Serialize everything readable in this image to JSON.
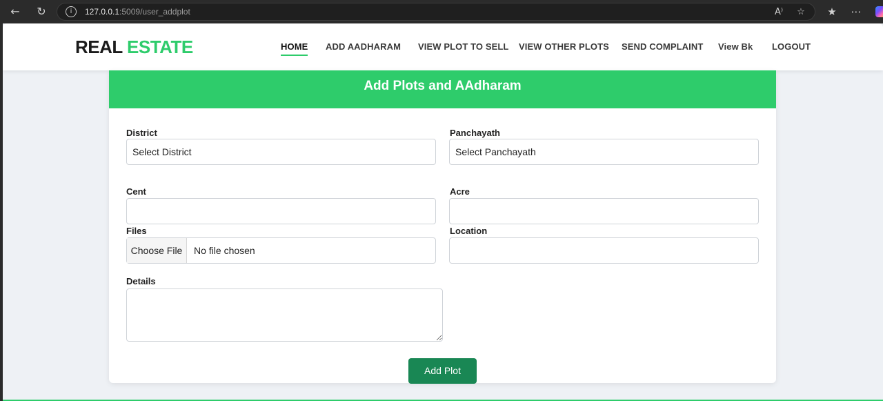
{
  "browser": {
    "url_host": "127.0.0.1",
    "url_rest": ":5009/user_addplot"
  },
  "navbar": {
    "logo_part1": "REAL",
    "logo_part2": "ESTATE",
    "items": [
      {
        "label": "HOME",
        "active": true
      },
      {
        "label": "ADD AADHARAM"
      },
      {
        "label": "VIEW PLOT TO SELL"
      },
      {
        "label": "VIEW OTHER PLOTS"
      },
      {
        "label": "SEND COMPLAINT"
      },
      {
        "label": "View Bk"
      },
      {
        "label": "LOGOUT"
      }
    ]
  },
  "form": {
    "title": "Add Plots and AAdharam",
    "district_label": "District",
    "district_value": "Select District",
    "panchayath_label": "Panchayath",
    "panchayath_value": "Select Panchayath",
    "cent_label": "Cent",
    "cent_value": "",
    "acre_label": "Acre",
    "acre_value": "",
    "files_label": "Files",
    "files_button": "Choose File",
    "files_status": "No file chosen",
    "location_label": "Location",
    "location_value": "",
    "details_label": "Details",
    "details_value": "",
    "submit_label": "Add Plot"
  },
  "colors": {
    "brand_green": "#2ecc6b",
    "button_green": "#198754"
  }
}
